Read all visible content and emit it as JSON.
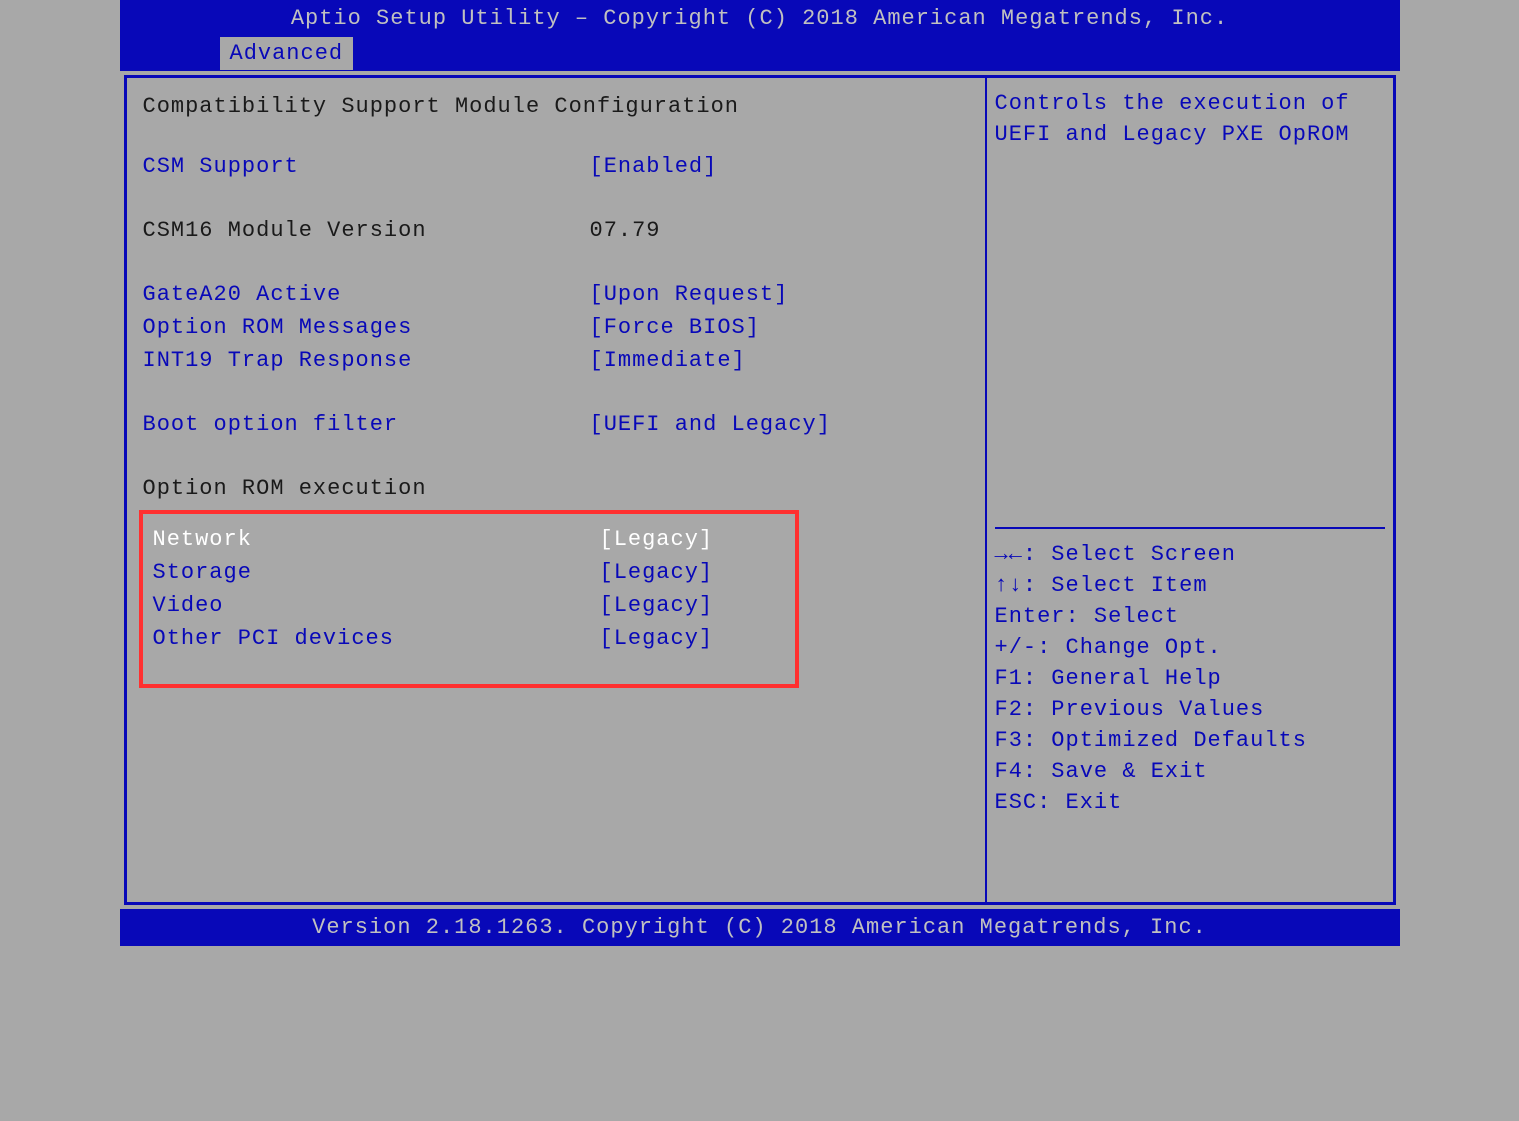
{
  "header": {
    "title": "Aptio Setup Utility – Copyright (C) 2018 American Megatrends, Inc."
  },
  "tab": {
    "label": "Advanced"
  },
  "main": {
    "section_title": "Compatibility Support Module Configuration",
    "csm_support": {
      "label": "CSM Support",
      "value": "[Enabled]"
    },
    "csm16_version": {
      "label": "CSM16 Module Version",
      "value": "07.79"
    },
    "gatea20": {
      "label": "GateA20 Active",
      "value": "[Upon Request]"
    },
    "option_rom_messages": {
      "label": "Option ROM Messages",
      "value": "[Force BIOS]"
    },
    "int19_trap": {
      "label": "INT19 Trap Response",
      "value": "[Immediate]"
    },
    "boot_option_filter": {
      "label": "Boot option filter",
      "value": "[UEFI and Legacy]"
    },
    "option_rom_execution_title": "Option ROM execution",
    "network": {
      "label": "Network",
      "value": "[Legacy]"
    },
    "storage": {
      "label": "Storage",
      "value": "[Legacy]"
    },
    "video": {
      "label": "Video",
      "value": "[Legacy]"
    },
    "other_pci": {
      "label": "Other PCI devices",
      "value": "[Legacy]"
    }
  },
  "help": {
    "description": "Controls the execution of UEFI and Legacy PXE OpROM",
    "select_screen": "→←: Select Screen",
    "select_item": "↑↓: Select Item",
    "enter": "Enter: Select",
    "change_opt": "+/-: Change Opt.",
    "f1": "F1: General Help",
    "f2": "F2: Previous Values",
    "f3": "F3: Optimized Defaults",
    "f4": "F4: Save & Exit",
    "esc": "ESC: Exit"
  },
  "footer": {
    "text": "Version 2.18.1263. Copyright (C) 2018 American Megatrends, Inc."
  }
}
